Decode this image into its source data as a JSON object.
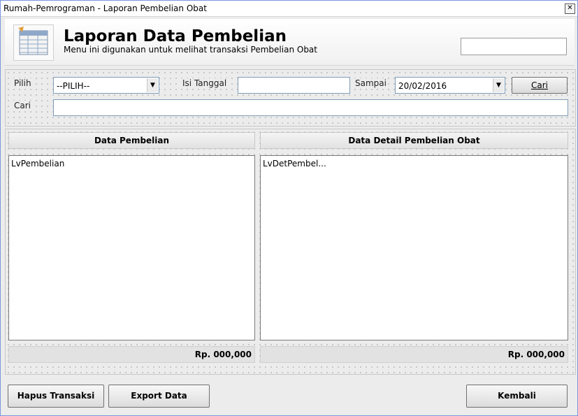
{
  "window": {
    "title": "Rumah-Pemrograman - Laporan Pembelian Obat",
    "close_glyph": "✕"
  },
  "header": {
    "title": "Laporan Data Pembelian",
    "subtitle": "Menu ini digunakan untuk melihat transaksi Pembelian Obat",
    "icon": "report-table-icon",
    "right_box": ""
  },
  "filter": {
    "pilih_label": "Pilih",
    "pilih_value": "--PILIH--",
    "isi_tanggal_label": "Isi Tanggal",
    "isi_tanggal_value": "",
    "sampai_label": "Sampai",
    "sampai_value": "20/02/2016",
    "cari_button": "Cari",
    "cari_label": "Cari",
    "cari_value": ""
  },
  "panels": {
    "left": {
      "header": "Data Pembelian",
      "list_text": "LvPembelian",
      "total": "Rp. 000,000"
    },
    "right": {
      "header": "Data Detail Pembelian Obat",
      "list_text": "LvDetPembel...",
      "total": "Rp. 000,000"
    }
  },
  "buttons": {
    "hapus": "Hapus Transaksi",
    "export": "Export Data",
    "kembali": "Kembali"
  },
  "colors": {
    "window_border": "#7a96df",
    "field_border": "#7f9db9",
    "background": "#ececec"
  }
}
